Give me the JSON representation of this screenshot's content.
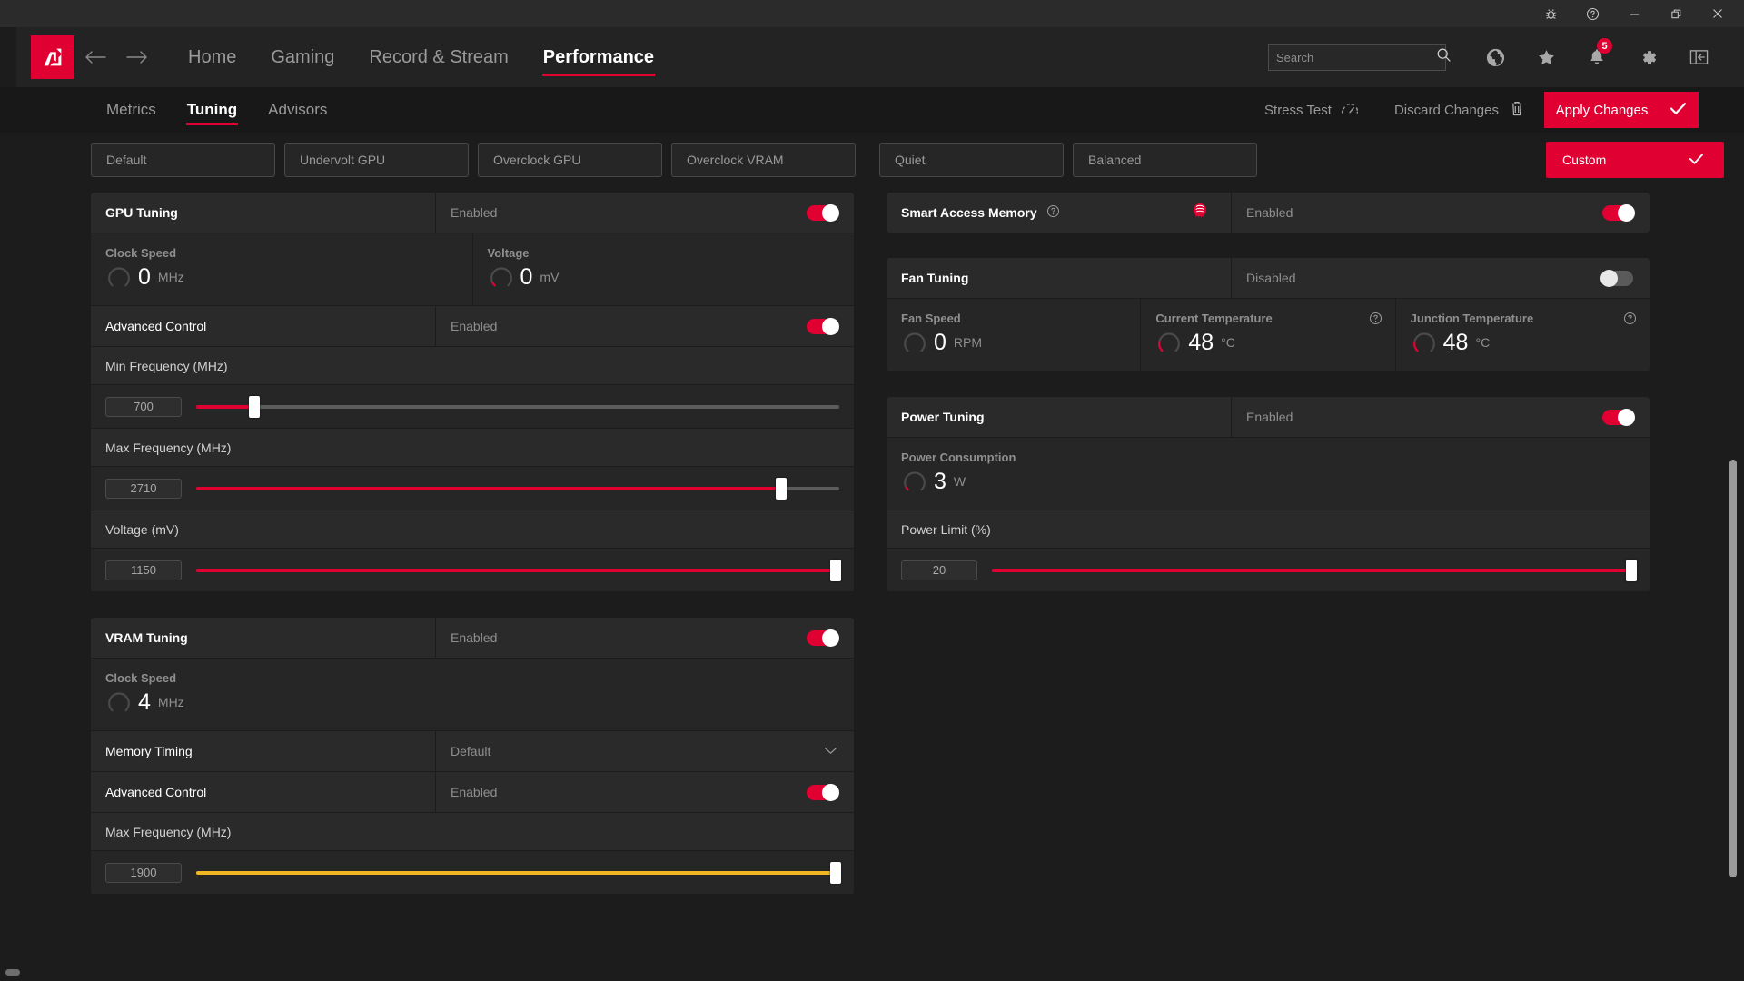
{
  "titlebar": {
    "buttons": [
      {
        "name": "bug-report",
        "icon": "bug-icon"
      },
      {
        "name": "help",
        "icon": "help-circle-icon"
      },
      {
        "name": "minimize",
        "icon": "minimize-icon"
      },
      {
        "name": "restore",
        "icon": "restore-icon"
      },
      {
        "name": "close",
        "icon": "close-icon"
      }
    ]
  },
  "nav": {
    "brand": "AMD",
    "back_icon": "arrow-left-icon",
    "forward_icon": "arrow-right-icon",
    "links": [
      {
        "label": "Home",
        "active": false
      },
      {
        "label": "Gaming",
        "active": false
      },
      {
        "label": "Record & Stream",
        "active": false
      },
      {
        "label": "Performance",
        "active": true
      }
    ],
    "search": {
      "placeholder": "Search",
      "value": ""
    },
    "icons": [
      {
        "name": "globe-icon",
        "badge": ""
      },
      {
        "name": "star-icon",
        "badge": ""
      },
      {
        "name": "bell-icon",
        "badge": "5"
      },
      {
        "name": "gear-icon",
        "badge": ""
      },
      {
        "name": "collapse-panel-icon",
        "badge": ""
      }
    ]
  },
  "subbar": {
    "tabs": [
      {
        "label": "Metrics",
        "active": false
      },
      {
        "label": "Tuning",
        "active": true
      },
      {
        "label": "Advisors",
        "active": false
      }
    ],
    "stress_test": "Stress Test",
    "discard": "Discard Changes",
    "apply": "Apply Changes"
  },
  "presets": {
    "gpu_group": [
      "Default",
      "Undervolt GPU",
      "Overclock GPU",
      "Overclock VRAM"
    ],
    "fan_group": [
      "Quiet",
      "Balanced"
    ],
    "custom": "Custom"
  },
  "gpu_tuning": {
    "title": "GPU Tuning",
    "state": "Enabled",
    "enabled": true,
    "metrics": [
      {
        "label": "Clock Speed",
        "value": "0",
        "unit": "MHz",
        "fill": 0.0
      },
      {
        "label": "Voltage",
        "value": "0",
        "unit": "mV",
        "fill": 0.03
      }
    ],
    "advanced_control": {
      "label": "Advanced Control",
      "state": "Enabled",
      "enabled": true
    },
    "sliders": [
      {
        "label": "Min Frequency (MHz)",
        "value": "700",
        "pos": 9,
        "color": "red"
      },
      {
        "label": "Max Frequency (MHz)",
        "value": "2710",
        "pos": 91,
        "color": "red"
      },
      {
        "label": "Voltage (mV)",
        "value": "1150",
        "pos": 99.5,
        "color": "red"
      }
    ]
  },
  "vram_tuning": {
    "title": "VRAM Tuning",
    "state": "Enabled",
    "enabled": true,
    "metrics": [
      {
        "label": "Clock Speed",
        "value": "4",
        "unit": "MHz",
        "fill": 0.0
      }
    ],
    "memory_timing": {
      "label": "Memory Timing",
      "value": "Default"
    },
    "advanced_control": {
      "label": "Advanced Control",
      "state": "Enabled",
      "enabled": true
    },
    "sliders": [
      {
        "label": "Max Frequency (MHz)",
        "value": "1900",
        "pos": 99.5,
        "color": "yellow"
      }
    ]
  },
  "smart_access_memory": {
    "title": "Smart Access Memory",
    "help_icon": "help-circle-icon",
    "logo_icon": "amd-ryzen-icon",
    "state": "Enabled",
    "enabled": true
  },
  "fan_tuning": {
    "title": "Fan Tuning",
    "state": "Disabled",
    "enabled": false,
    "metrics": [
      {
        "label": "Fan Speed",
        "value": "0",
        "unit": "RPM",
        "fill": 0.0,
        "help": false
      },
      {
        "label": "Current Temperature",
        "value": "48",
        "unit": "°C",
        "fill": 0.33,
        "help": true
      },
      {
        "label": "Junction Temperature",
        "value": "48",
        "unit": "°C",
        "fill": 0.33,
        "help": true
      }
    ]
  },
  "power_tuning": {
    "title": "Power Tuning",
    "state": "Enabled",
    "enabled": true,
    "metrics": [
      {
        "label": "Power Consumption",
        "value": "3",
        "unit": "W",
        "fill": 0.03,
        "help": false
      }
    ],
    "sliders": [
      {
        "label": "Power Limit (%)",
        "value": "20",
        "pos": 99.5,
        "color": "red"
      }
    ]
  },
  "colors": {
    "accent": "#e00032",
    "yellow": "#f0b722",
    "card_bg": "#262626",
    "row_bg": "#2a2a2a",
    "page_bg": "#1c1c1c"
  }
}
